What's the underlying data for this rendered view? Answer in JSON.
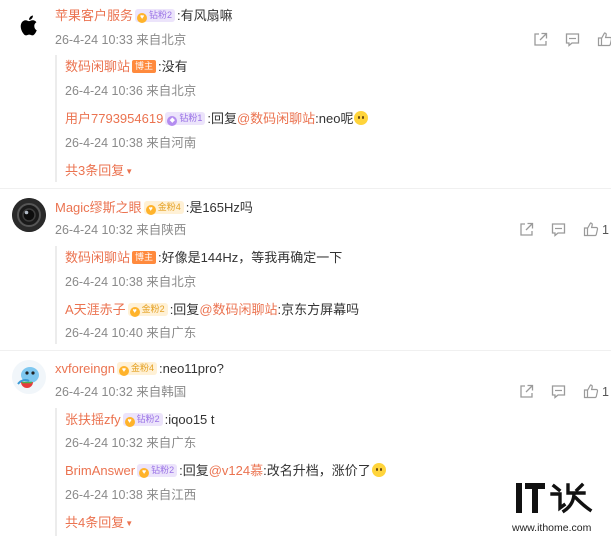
{
  "comments": [
    {
      "user": "苹果客户服务",
      "badge": "钻粉2",
      "text": ":有风扇嘛",
      "meta": "26-4-24 10:33 来自北京",
      "replies": [
        {
          "user": "数码闲聊站",
          "badge": "博主",
          "text": ":没有",
          "meta": "26-4-24 10:36 来自北京"
        },
        {
          "user": "用户7793954619",
          "badge": "钻粉1",
          "reply_prefix": ":回复",
          "mention": "@数码闲聊站",
          "text": ":neo呢",
          "meta": "26-4-24 10:38 来自河南"
        }
      ],
      "more": "共3条回复",
      "like_count": ""
    },
    {
      "user": "Magic缪斯之眼",
      "badge": "金粉4",
      "text": ":是165Hz吗",
      "meta": "26-4-24 10:32 来自陕西",
      "replies": [
        {
          "user": "数码闲聊站",
          "badge": "博主",
          "text": ":好像是144Hz，等我再确定一下",
          "meta": "26-4-24 10:38 来自北京"
        },
        {
          "user": "A天涯赤子",
          "badge": "金粉2",
          "reply_prefix": ":回复",
          "mention": "@数码闲聊站",
          "text": ":京东方屏幕吗",
          "meta": "26-4-24 10:40 来自广东"
        }
      ],
      "like_count": "1"
    },
    {
      "user": "xvforeingn",
      "badge": "金粉4",
      "text": ":neo11pro?",
      "meta": "26-4-24 10:32 来自韩国",
      "replies": [
        {
          "user": "张扶摇zfy",
          "badge": "钻粉2",
          "text": ":iqoo15 t",
          "meta": "26-4-24 10:32 来自广东"
        },
        {
          "user": "BrimAnswer",
          "badge": "钻粉2",
          "reply_prefix": ":回复",
          "mention": "@v124慕",
          "text": ":改名升档，涨价了",
          "meta": "26-4-24 10:38 来自江西"
        }
      ],
      "more": "共4条回复",
      "like_count": "1"
    }
  ],
  "watermark": {
    "url": "www.ithome.com"
  },
  "icons": [
    "apple-logo-icon",
    "share-icon",
    "comment-icon",
    "like-icon",
    "caret-down-icon"
  ],
  "colors": {
    "username": "#eb7350",
    "meta": "#8a8a8a",
    "text": "#333333"
  }
}
